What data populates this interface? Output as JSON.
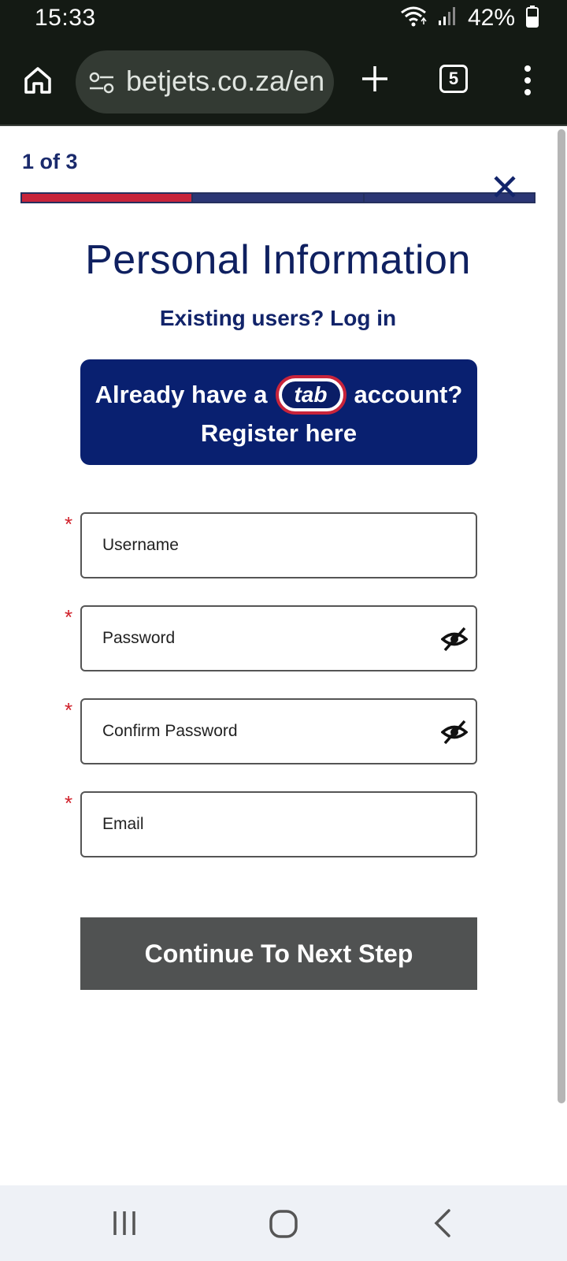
{
  "status_bar": {
    "time": "15:33",
    "battery_text": "42%",
    "icons": [
      "wifi-icon",
      "signal-icon",
      "battery-icon"
    ]
  },
  "browser": {
    "url": "betjets.co.za/en",
    "tab_count": "5",
    "icons": [
      "home-icon",
      "tune-icon",
      "plus-icon",
      "tabs-icon",
      "more-vert-icon"
    ]
  },
  "page": {
    "step_label": "1 of 3",
    "title": "Personal Information",
    "login_link": "Existing users? Log in",
    "banner": {
      "line1_before": "Already have a",
      "logo_text": "tab",
      "line1_after": "account?",
      "line2": "Register here"
    },
    "fields": [
      {
        "label": "Username"
      },
      {
        "label": "Password"
      },
      {
        "label": "Confirm Password"
      },
      {
        "label": "Email"
      }
    ],
    "required_marker": "*",
    "continue_label": "Continue To Next Step"
  },
  "colors": {
    "navy": "#092070",
    "red": "#c8243b",
    "button_gray": "#505252"
  },
  "nav_bar": {
    "icons": [
      "recents-icon",
      "home-circle-icon",
      "back-icon"
    ]
  }
}
